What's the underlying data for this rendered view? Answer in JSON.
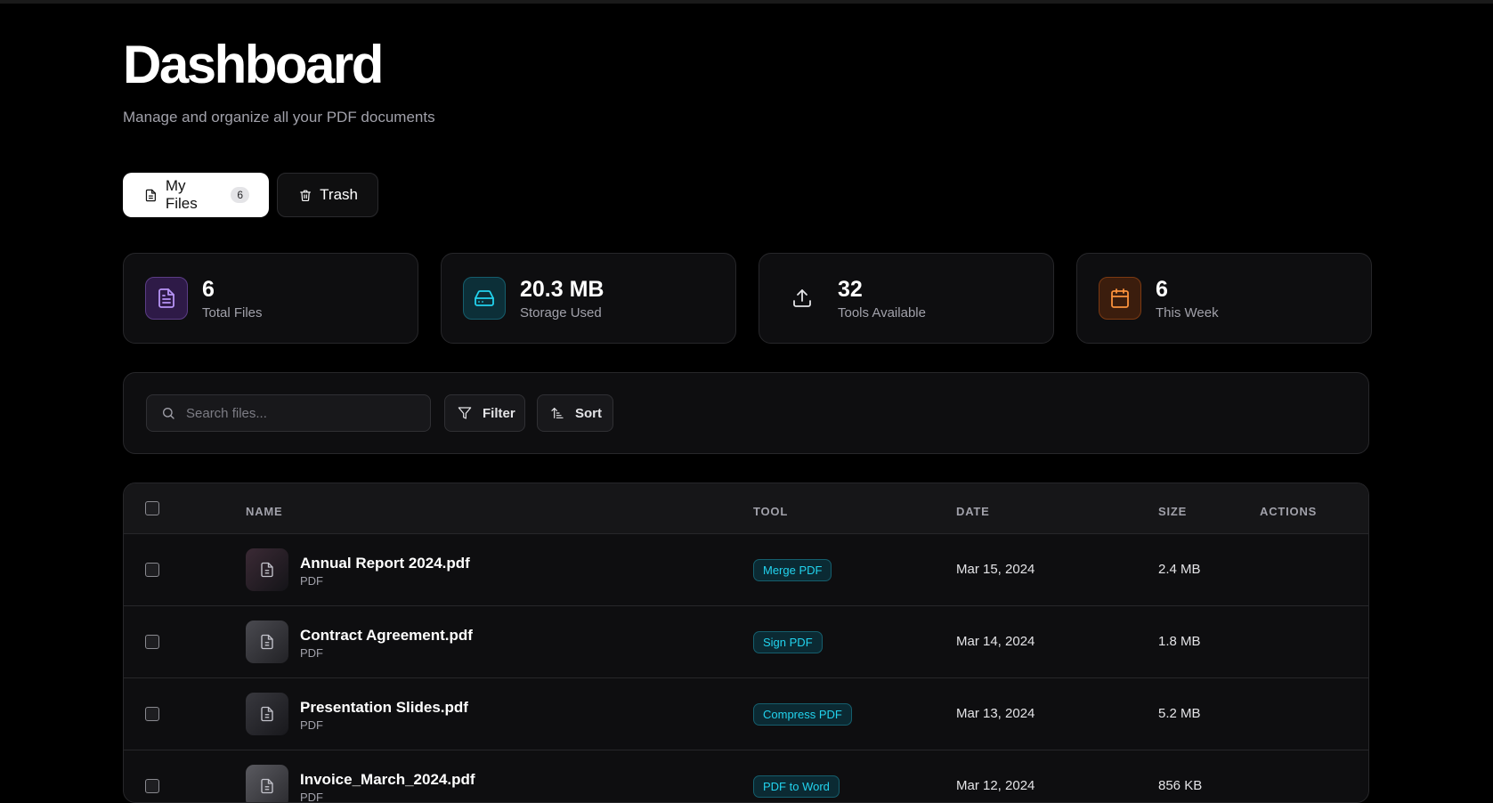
{
  "header": {
    "title": "Dashboard",
    "subtitle": "Manage and organize all your PDF documents"
  },
  "tabs": [
    {
      "label": "My Files",
      "badge": "6",
      "icon": "file-icon",
      "active": true
    },
    {
      "label": "Trash",
      "icon": "trash-icon",
      "active": false
    }
  ],
  "stats": [
    {
      "value": "6",
      "label": "Total Files",
      "icon": "file-text-icon",
      "color": "#b794f6"
    },
    {
      "value": "20.3 MB",
      "label": "Storage Used",
      "icon": "hard-drive-icon",
      "color": "#22d3ee"
    },
    {
      "value": "32",
      "label": "Tools Available",
      "icon": "upload-icon",
      "color": "#e4e4e7"
    },
    {
      "value": "6",
      "label": "This Week",
      "icon": "calendar-icon",
      "color": "#fb923c"
    }
  ],
  "toolbar": {
    "search_placeholder": "Search files...",
    "filter_label": "Filter",
    "sort_label": "Sort"
  },
  "table": {
    "columns": [
      "NAME",
      "TOOL",
      "DATE",
      "SIZE",
      "ACTIONS"
    ],
    "rows": [
      {
        "name": "Annual Report 2024.pdf",
        "type": "PDF",
        "tool": "Merge PDF",
        "date": "Mar 15, 2024",
        "size": "2.4 MB"
      },
      {
        "name": "Contract Agreement.pdf",
        "type": "PDF",
        "tool": "Sign PDF",
        "date": "Mar 14, 2024",
        "size": "1.8 MB"
      },
      {
        "name": "Presentation Slides.pdf",
        "type": "PDF",
        "tool": "Compress PDF",
        "date": "Mar 13, 2024",
        "size": "5.2 MB"
      },
      {
        "name": "Invoice_March_2024.pdf",
        "type": "PDF",
        "tool": "PDF to Word",
        "date": "Mar 12, 2024",
        "size": "856 KB"
      }
    ]
  },
  "colors": {
    "accent_cyan": "#22d3ee",
    "background": "#000000",
    "card": "#0e0e10"
  }
}
